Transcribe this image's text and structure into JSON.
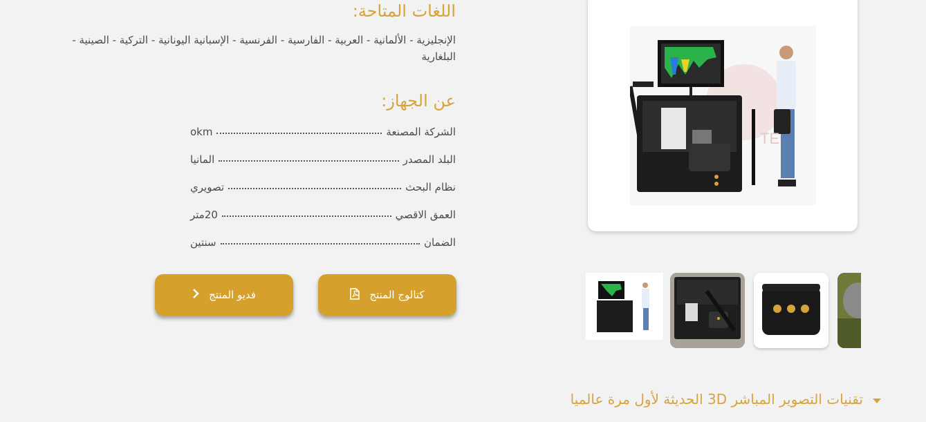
{
  "languages": {
    "title": "اللغات المتاحة:",
    "text": "الإنجليزية - الألمانية - العربية - الفارسية - الفرنسية - الإسبانية اليونانية - التركية - الصينية - البلغارية"
  },
  "about": {
    "title": "عن الجهاز:",
    "specs": [
      {
        "label": "الشركة المصنعة",
        "value": "okm"
      },
      {
        "label": "البلد المصدر",
        "value": "المانيا"
      },
      {
        "label": "نظام البحث",
        "value": "تصويري"
      },
      {
        "label": "العمق الاقصي",
        "value": "20متر"
      },
      {
        "label": "الضمان",
        "value": "سنتين"
      }
    ]
  },
  "buttons": {
    "catalog_label": "كتالوج المنتج",
    "video_label": "فديو المنتج"
  },
  "accordion": {
    "title": "تقنيات التصوير المباشر 3D الحديثة لأول مرة عالميا"
  },
  "colors": {
    "accent": "#d6a43b",
    "button": "#d6a02d",
    "background": "#f2f2f2"
  },
  "icons": {
    "catalog": "file-pdf-icon",
    "video": "chevron-right-icon",
    "accordion": "caret-down-icon"
  }
}
